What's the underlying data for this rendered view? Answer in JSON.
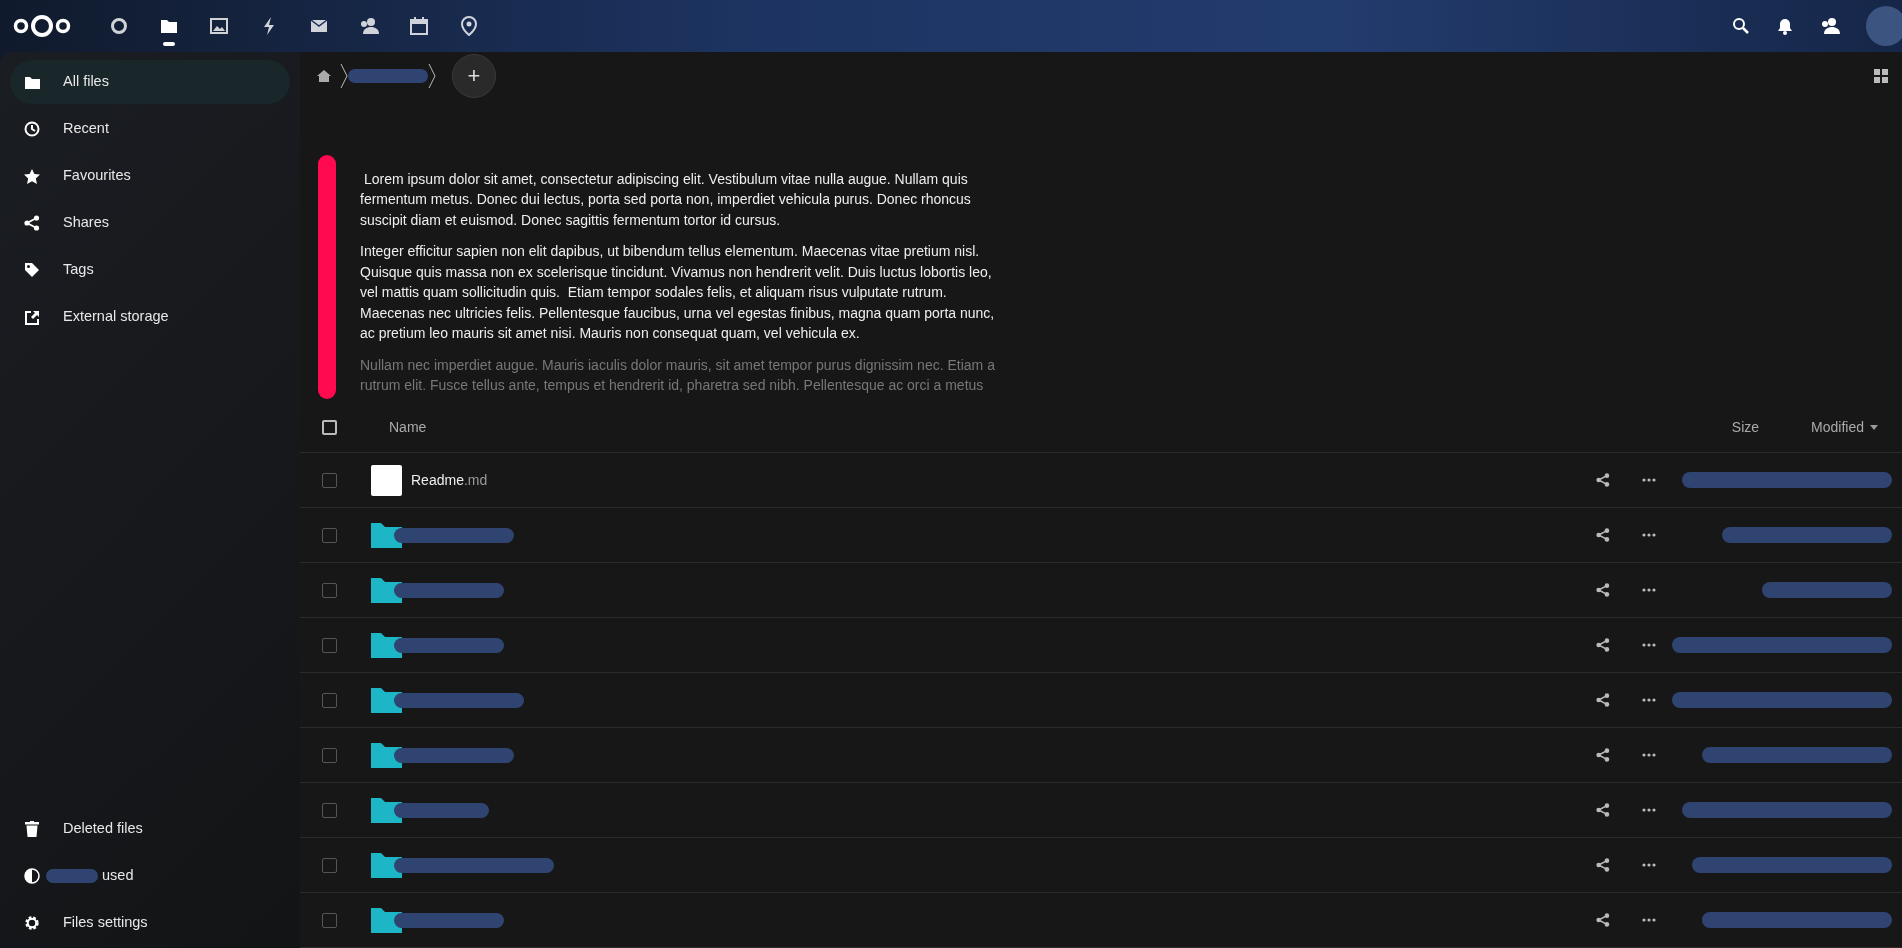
{
  "apps": [
    {
      "kind": "dashboard",
      "selected": false
    },
    {
      "kind": "files",
      "selected": true
    },
    {
      "kind": "photos",
      "selected": false
    },
    {
      "kind": "activity",
      "selected": false
    },
    {
      "kind": "mail",
      "selected": false
    },
    {
      "kind": "contacts",
      "selected": false
    },
    {
      "kind": "calendar",
      "selected": false
    },
    {
      "kind": "maps",
      "selected": false
    }
  ],
  "sidebar": {
    "items": [
      {
        "kind": "folder",
        "label": "All files",
        "selected": true
      },
      {
        "kind": "clock",
        "label": "Recent",
        "selected": false
      },
      {
        "kind": "star",
        "label": "Favourites",
        "selected": false
      },
      {
        "kind": "share",
        "label": "Shares",
        "selected": false
      },
      {
        "kind": "tag",
        "label": "Tags",
        "selected": false
      },
      {
        "kind": "external",
        "label": "External storage",
        "selected": false
      }
    ],
    "footer": [
      {
        "kind": "trash",
        "label": "Deleted files"
      },
      {
        "kind": "quota",
        "label": "used"
      },
      {
        "kind": "gear",
        "label": "Files settings"
      }
    ]
  },
  "breadcrumb": {
    "add_label": "+"
  },
  "readme": {
    "paragraphs": [
      {
        "text": " Lorem ipsum dolor sit amet, consectetur adipiscing elit. Vestibulum vitae nulla augue. Nullam quis fermentum metus. Donec dui lectus, porta sed porta non, imperdiet vehicula purus. Donec rhoncus suscipit diam et euismod. Donec sagittis fermentum tortor id cursus.",
        "faded": false
      },
      {
        "text": "Integer efficitur sapien non elit dapibus, ut bibendum tellus elementum. Maecenas vitae pretium nisl. Quisque quis massa non ex scelerisque tincidunt. Vivamus non hendrerit velit. Duis luctus lobortis leo, vel mattis quam sollicitudin quis.  Etiam tempor sodales felis, et aliquam risus vulputate rutrum. Maecenas nec ultricies felis. Pellentesque faucibus, urna vel egestas finibus, magna quam porta nunc, ac pretium leo mauris sit amet nisi. Mauris non consequat quam, vel vehicula ex.",
        "faded": false
      },
      {
        "text": "Nullam nec imperdiet augue. Mauris iaculis dolor mauris, sit amet tempor purus dignissim nec. Etiam a rutrum elit. Fusce tellus ante, tempus et hendrerit id, pharetra sed nibh. Pellentesque ac orci a metus",
        "faded": true
      }
    ]
  },
  "table": {
    "select_all": {
      "checked": false
    },
    "columns": [
      "Name",
      "Size",
      "Modified"
    ],
    "rows": [
      {
        "kind": "file",
        "name": "Readme",
        "extension": ".md",
        "checked": false
      },
      {
        "kind": "folder",
        "checked": false
      },
      {
        "kind": "folder",
        "checked": false
      },
      {
        "kind": "folder",
        "checked": false
      },
      {
        "kind": "folder",
        "checked": false
      },
      {
        "kind": "folder",
        "checked": false
      },
      {
        "kind": "folder",
        "checked": false
      },
      {
        "kind": "folder",
        "checked": false
      },
      {
        "kind": "folder",
        "checked": false
      }
    ]
  }
}
